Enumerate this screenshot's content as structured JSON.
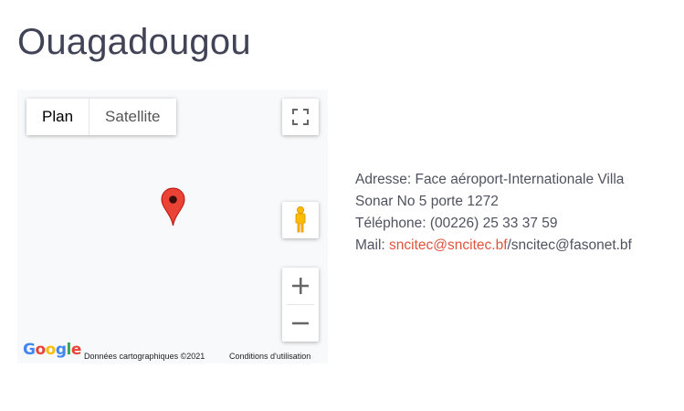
{
  "page": {
    "title": "Ouagadougou"
  },
  "map": {
    "type_buttons": [
      {
        "label": "Plan",
        "active": true
      },
      {
        "label": "Satellite",
        "active": false
      }
    ],
    "attribution": "Données cartographiques ©2021",
    "terms": "Conditions d'utilisation",
    "logo_text": "Google",
    "marker_color": "#ea4335",
    "icons": {
      "fullscreen": "fullscreen-icon",
      "pegman": "pegman-icon",
      "zoom_in": "plus-icon",
      "zoom_out": "minus-icon",
      "marker": "map-marker-icon"
    }
  },
  "contact": {
    "address_line1": "Adresse: Face aéroport-Internationale Villa",
    "address_line2": "Sonar No 5 porte 1272",
    "phone": "Téléphone: (00226) 25 33 37 59",
    "mail_label": "Mail: ",
    "mail_link": "sncitec@sncitec.bf",
    "mail_rest": "/sncitec@fasonet.bf",
    "link_color": "#e0533c"
  }
}
